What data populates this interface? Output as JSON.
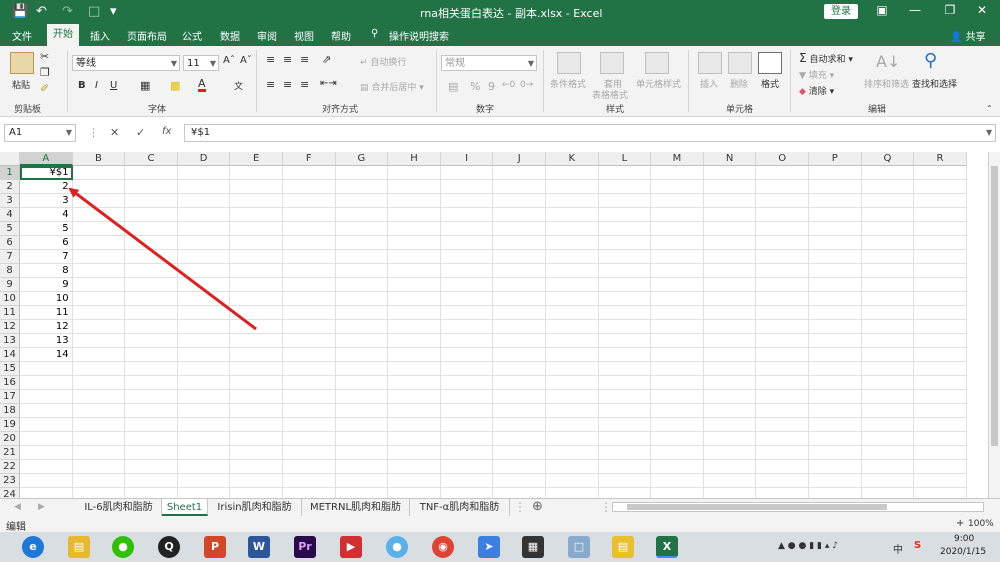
{
  "window": {
    "title": "rna相关蛋白表达 - 副本.xlsx  -  Excel",
    "login_label": "登录"
  },
  "tabs": [
    "文件",
    "开始",
    "插入",
    "页面布局",
    "公式",
    "数据",
    "审阅",
    "视图",
    "帮助"
  ],
  "search_hint": "操作说明搜索",
  "share_label": "共享",
  "ribbon": {
    "clipboard": {
      "paste": "粘贴",
      "group": "剪贴板"
    },
    "font": {
      "name": "等线",
      "size": "11",
      "group": "字体",
      "bold": "B",
      "italic": "I",
      "underline": "U"
    },
    "alignment": {
      "wrap": "自动换行",
      "merge": "合并后居中",
      "group": "对齐方式"
    },
    "number": {
      "format": "常规",
      "group": "数字",
      "percent": "%",
      "comma": "9"
    },
    "styles": {
      "conditional": "条件格式",
      "table_line1": "套用",
      "table_line2": "表格格式",
      "cell_styles": "单元格样式",
      "group": "样式"
    },
    "cells": {
      "insert": "插入",
      "delete": "删除",
      "format": "格式",
      "group": "单元格"
    },
    "editing": {
      "autosum": "自动求和",
      "fill": "填充",
      "clear": "清除",
      "sort": "排序和筛选",
      "find": "查找和选择",
      "group": "编辑"
    }
  },
  "formula_bar": {
    "name_box": "A1",
    "fx": "fx",
    "value": "¥$1"
  },
  "columns": [
    "A",
    "B",
    "C",
    "D",
    "E",
    "F",
    "G",
    "H",
    "I",
    "J",
    "K",
    "L",
    "M",
    "N",
    "O",
    "P",
    "Q",
    "R"
  ],
  "rows": [
    "1",
    "2",
    "3",
    "4",
    "5",
    "6",
    "7",
    "8",
    "9",
    "10",
    "11",
    "12",
    "13",
    "14",
    "15",
    "16",
    "17",
    "18",
    "19",
    "20",
    "21",
    "22",
    "23",
    "24"
  ],
  "col_a_values": [
    "¥$1",
    "2",
    "3",
    "4",
    "5",
    "6",
    "7",
    "8",
    "9",
    "10",
    "11",
    "12",
    "13",
    "14"
  ],
  "sheets": [
    "IL-6肌肉和脂肪",
    "Sheet1",
    "Irisin肌肉和脂肪",
    "METRNL肌肉和脂肪",
    "TNF-α肌肉和脂肪"
  ],
  "active_sheet": "Sheet1",
  "status": {
    "mode": "编辑",
    "zoom": "100%"
  },
  "taskbar": {
    "time": "9:00",
    "date": "2020/1/15",
    "ime": "中"
  },
  "colors": {
    "accent": "#217346",
    "arrow": "#e02020"
  }
}
